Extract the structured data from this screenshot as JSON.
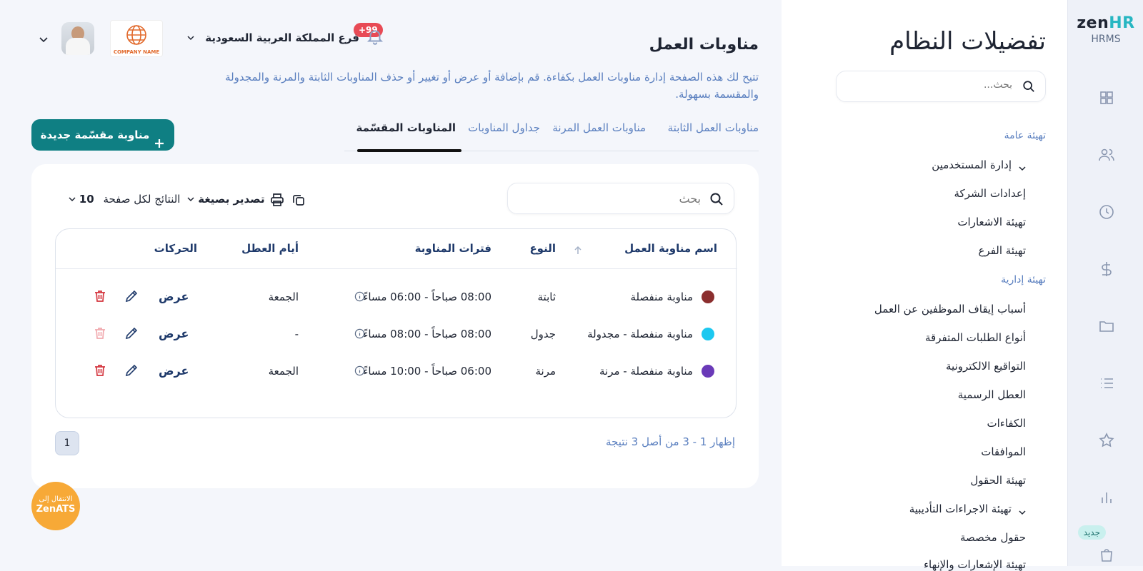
{
  "app": {
    "logo_zen": "zen",
    "logo_hr": "HR",
    "logo_sub": "HRMS",
    "new_badge": "جديد"
  },
  "header": {
    "notifications_badge": "+99",
    "branch": "فرع المملكة العربية السعودية",
    "company_logo_text": "COMPANY NAME"
  },
  "settings": {
    "title": "تفضيلات النظام",
    "search_placeholder": "بحث...",
    "group_general": "تهيئة عامة",
    "group_admin": "تهيئة إدارية",
    "items_general": [
      "إدارة المستخدمين",
      "إعدادات الشركة",
      "تهيئة الاشعارات",
      "تهيئة الفرع"
    ],
    "items_admin": [
      "أسباب إيقاف الموظفين عن العمل",
      "أنواع الطلبات المتفرقة",
      "التواقيع الالكترونية",
      "العطل الرسمية",
      "الكفاءات",
      "الموافقات",
      "تهيئة الحقول",
      "تهيئة الاجراءات التأديبية",
      "حقول مخصصة",
      "تهيئة الإشعارات والإنهاء"
    ]
  },
  "page": {
    "title": "مناوبات العمل",
    "description": "تتيح لك هذه الصفحة إدارة مناوبات العمل بكفاءة. قم بإضافة أو عرض أو تغيير أو حذف المناوبات الثابتة والمرنة والمجدولة والمقسمة بسهولة.",
    "tabs": [
      "مناوبات العمل الثابتة",
      "مناوبات العمل المرنة",
      "جداول المناوبات",
      "المناوبات المقسّمة"
    ],
    "active_tab": 3,
    "new_button": "مناوبة مقسّمة جديدة"
  },
  "table": {
    "search_placeholder": "بحث",
    "export_label": "تصدير بصيغة",
    "per_page_label": "النتائج لكل صفحة",
    "per_page_value": "10",
    "columns": [
      "اسم مناوبة العمل",
      "النوع",
      "فترات المناوبة",
      "أيام العطل",
      "الحركات"
    ],
    "rows": [
      {
        "name": "مناوبة منفصلة",
        "color": "#8b2e2e",
        "type": "ثابتة",
        "period": "08:00 صباحاً - 06:00 مساءً",
        "off_days": "الجمعة",
        "view": "عرض",
        "delete_enabled": true
      },
      {
        "name": "مناوبة منفصلة - مجدولة",
        "color": "#1cc8f0",
        "type": "جدول",
        "period": "08:00 صباحاً - 08:00 مساءً",
        "off_days": "-",
        "view": "عرض",
        "delete_enabled": false
      },
      {
        "name": "مناوبة منفصلة - مرنة",
        "color": "#6a3ab8",
        "type": "مرنة",
        "period": "06:00 صباحاً - 10:00 مساءً",
        "off_days": "الجمعة",
        "view": "عرض",
        "delete_enabled": true
      }
    ],
    "page_number": "1",
    "showing": "إظهار 1 - 3 من أصل 3 نتيجة"
  },
  "ats": {
    "line1": "الانتقال إلى",
    "line2": "ZenATS"
  },
  "colors": {
    "primary": "#0f7f83",
    "accent_text": "#5a7fbf",
    "danger": "#d4363f",
    "badge": "#e84a55",
    "ats": "#f7a937"
  }
}
